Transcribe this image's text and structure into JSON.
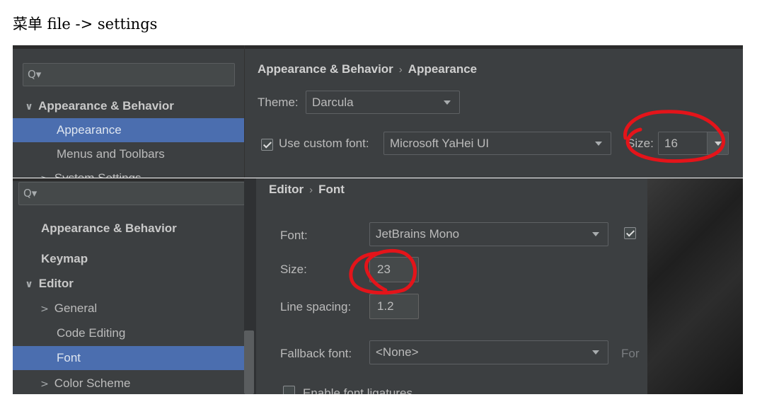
{
  "caption": "菜单  file -> settings",
  "panel1": {
    "search_glyph": "Q▾",
    "tree": [
      {
        "label": "Appearance & Behavior",
        "arrow": "∨"
      },
      {
        "label": "Appearance"
      },
      {
        "label": "Menus and Toolbars"
      },
      {
        "label": "System Settings",
        "arrow": ">"
      }
    ],
    "breadcrumb": {
      "parent": "Appearance & Behavior",
      "separator": "›",
      "current": "Appearance"
    },
    "theme": {
      "label": "Theme:",
      "value": "Darcula"
    },
    "custom_font": {
      "checked": true,
      "label": "Use custom font:",
      "value": "Microsoft YaHei UI"
    },
    "size": {
      "label": "Size:",
      "value": "16"
    }
  },
  "panel2": {
    "search_glyph": "Q▾",
    "tree": [
      {
        "label": "Appearance & Behavior"
      },
      {
        "label": "Keymap"
      },
      {
        "label": "Editor",
        "arrow": "∨"
      },
      {
        "label": "General",
        "arrow": ">"
      },
      {
        "label": "Code Editing"
      },
      {
        "label": "Font"
      },
      {
        "label": "Color Scheme",
        "arrow": ">"
      }
    ],
    "breadcrumb": {
      "parent": "Editor",
      "separator": "›",
      "current": "Font"
    },
    "font": {
      "label": "Font:",
      "value": "JetBrains Mono"
    },
    "size": {
      "label": "Size:",
      "value": "23"
    },
    "line_spacing": {
      "label": "Line spacing:",
      "value": "1.2"
    },
    "fallback_font": {
      "label": "Fallback font:",
      "value": "<None>",
      "note": "For"
    },
    "ligatures": {
      "label": "Enable font ligatures",
      "checked": false
    }
  },
  "colors": {
    "annotation": "#e4141a",
    "selection": "#4b6eaf",
    "panel_bg": "#3c3f41"
  }
}
